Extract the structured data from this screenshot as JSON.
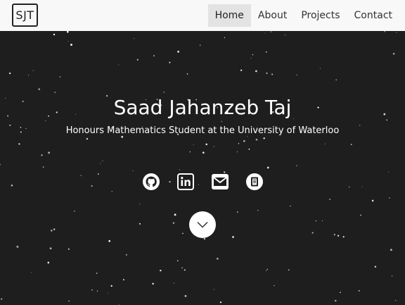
{
  "nav": {
    "logo": "SJT",
    "links": [
      {
        "label": "Home",
        "active": true
      },
      {
        "label": "About",
        "active": false
      },
      {
        "label": "Projects",
        "active": false
      },
      {
        "label": "Contact",
        "active": false
      }
    ]
  },
  "hero": {
    "name": "Saad Jahanzeb Taj",
    "subtitle": "Honours Mathematics Student at the University of Waterloo",
    "social": [
      {
        "icon": "github-icon"
      },
      {
        "icon": "linkedin-icon"
      },
      {
        "icon": "email-icon"
      },
      {
        "icon": "resume-icon"
      }
    ],
    "scroll_icon": "chevron-down-icon"
  },
  "colors": {
    "navbar_bg": "#f8f8f8",
    "active_link_bg": "#e3e3e3",
    "hero_bg": "#1e1e1e",
    "text_light": "#ffffff"
  }
}
